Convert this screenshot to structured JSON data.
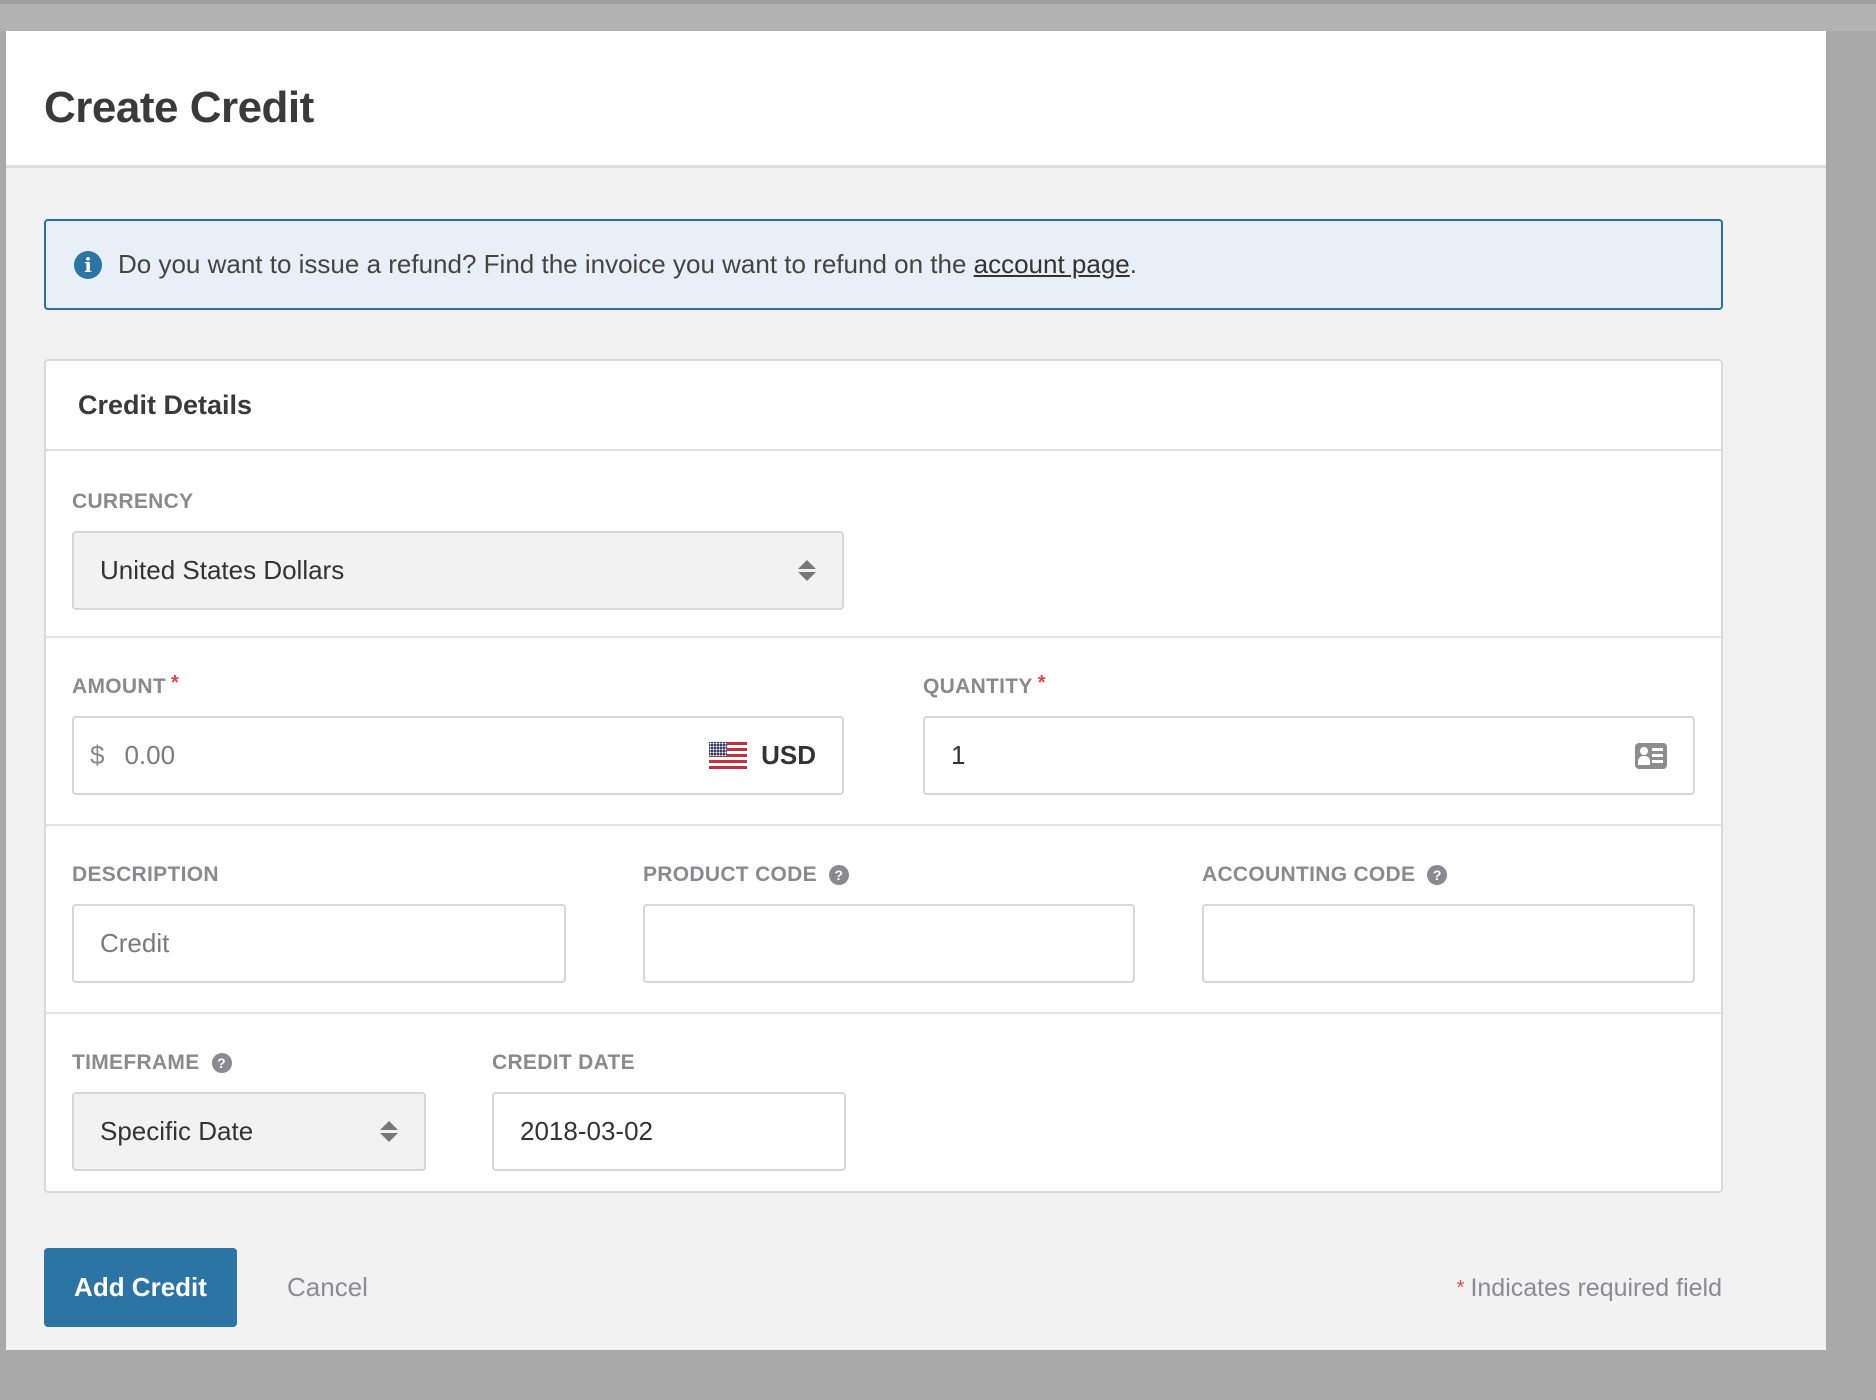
{
  "page": {
    "title": "Create Credit"
  },
  "info_banner": {
    "icon": "info-circle-icon",
    "text": "Do you want to issue a refund? Find the invoice you want to refund on the ",
    "link_label": "account page",
    "suffix": "."
  },
  "card": {
    "title": "Credit Details",
    "currency": {
      "label": "CURRENCY",
      "value": "United States Dollars"
    },
    "amount": {
      "label": "AMOUNT",
      "required_mark": "*",
      "prefix": "$",
      "placeholder": "0.00",
      "value": "",
      "currency_code": "USD",
      "flag_icon": "us-flag-icon"
    },
    "quantity": {
      "label": "QUANTITY",
      "required_mark": "*",
      "value": "1",
      "icon": "contact-card-icon"
    },
    "description": {
      "label": "DESCRIPTION",
      "placeholder": "Credit",
      "value": ""
    },
    "product_code": {
      "label": "PRODUCT CODE",
      "help_icon": "question-circle-icon",
      "value": ""
    },
    "accounting_code": {
      "label": "ACCOUNTING CODE",
      "help_icon": "question-circle-icon",
      "value": ""
    },
    "timeframe": {
      "label": "TIMEFRAME",
      "help_icon": "question-circle-icon",
      "value": "Specific Date"
    },
    "credit_date": {
      "label": "CREDIT DATE",
      "value": "2018-03-02"
    }
  },
  "actions": {
    "submit_label": "Add Credit",
    "cancel_label": "Cancel",
    "required_mark": "*",
    "required_note": "Indicates required field"
  },
  "colors": {
    "primary": "#2b74a3",
    "required": "#e0474c",
    "info_bg": "#e8eff6"
  }
}
